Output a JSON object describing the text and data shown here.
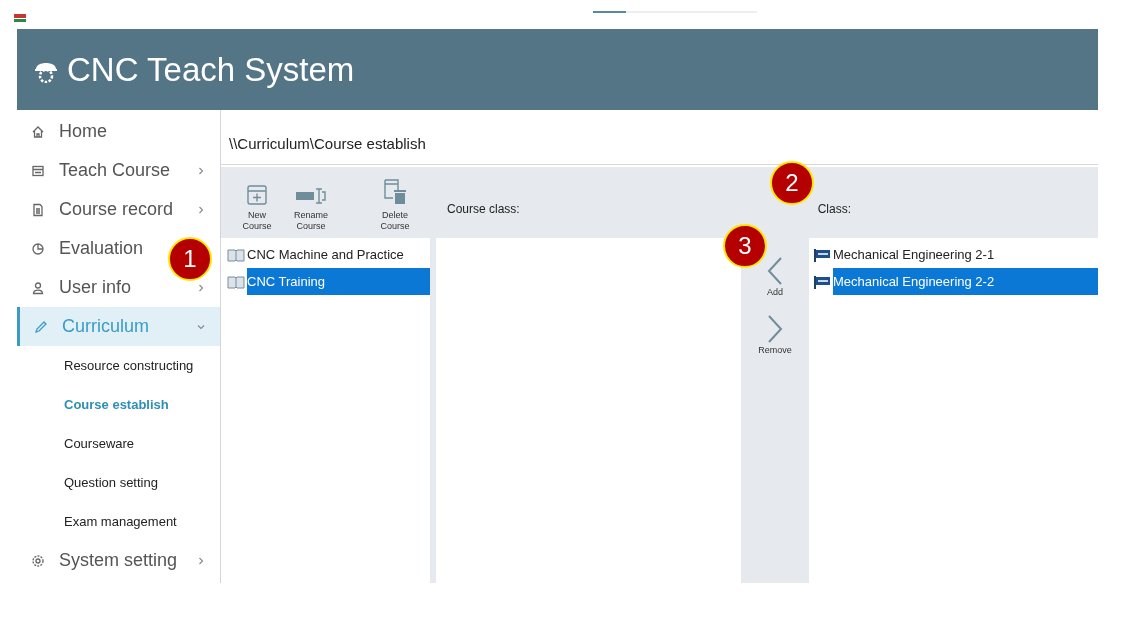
{
  "loading_bar": {
    "level": 0.2
  },
  "header": {
    "title": "CNC Teach System"
  },
  "sidebar": {
    "items": [
      {
        "label": "Home",
        "selected": false
      },
      {
        "label": "Teach Course",
        "expanded": false,
        "selected": false
      },
      {
        "label": "Course record",
        "expanded": false,
        "selected": false
      },
      {
        "label": "Evaluation",
        "selected": false
      },
      {
        "label": "User info",
        "expanded": false,
        "selected": false
      },
      {
        "label": "Curriculum",
        "expanded": true,
        "selected": true,
        "children": [
          {
            "label": "Resource constructing",
            "selected": false
          },
          {
            "label": "Course establish",
            "selected": true
          },
          {
            "label": "Courseware",
            "selected": false
          },
          {
            "label": "Question setting",
            "selected": false
          },
          {
            "label": "Exam management",
            "selected": false
          }
        ]
      },
      {
        "label": "System setting",
        "expanded": false,
        "selected": false
      }
    ]
  },
  "breadcrumb": "\\\\Curriculum\\Course establish",
  "toolbar": [
    {
      "label": "New Course"
    },
    {
      "label": "Rename Course"
    },
    {
      "label": "Delete Course"
    }
  ],
  "course_class_label": "Course class:",
  "class_label": "Class:",
  "courses": [
    {
      "name": "CNC Machine and Practice",
      "selected": false
    },
    {
      "name": "CNC Training",
      "selected": true
    }
  ],
  "transfer": [
    {
      "label": "Add"
    },
    {
      "label": "Remove"
    }
  ],
  "classes": [
    {
      "name": "Mechanical Engineering 2-1",
      "selected": false
    },
    {
      "name": "Mechanical Engineering 2-2",
      "selected": true
    }
  ],
  "callouts": [
    {
      "label": "1"
    },
    {
      "label": "2"
    },
    {
      "label": "3"
    }
  ]
}
